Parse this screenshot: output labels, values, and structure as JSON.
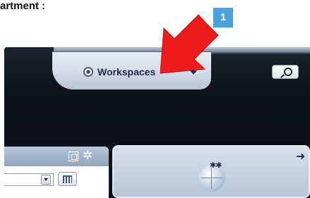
{
  "caption": {
    "text": "artment :"
  },
  "header": {
    "workspaces_label": "Workspaces",
    "search_icon": "search-icon"
  },
  "callout": {
    "step_number": "1",
    "arrow_color": "#ee1c1c",
    "badge_color": "#4aa3df"
  },
  "left_panel": {
    "restore_icon": "restore-window-icon",
    "settings_icon": "gear-icon",
    "dropdown_value": "",
    "calendar_icon": "calendar-icon"
  },
  "right_panel": {
    "navigate_icon": "arrow-right-icon",
    "globe_icon": "globe-icon"
  }
}
